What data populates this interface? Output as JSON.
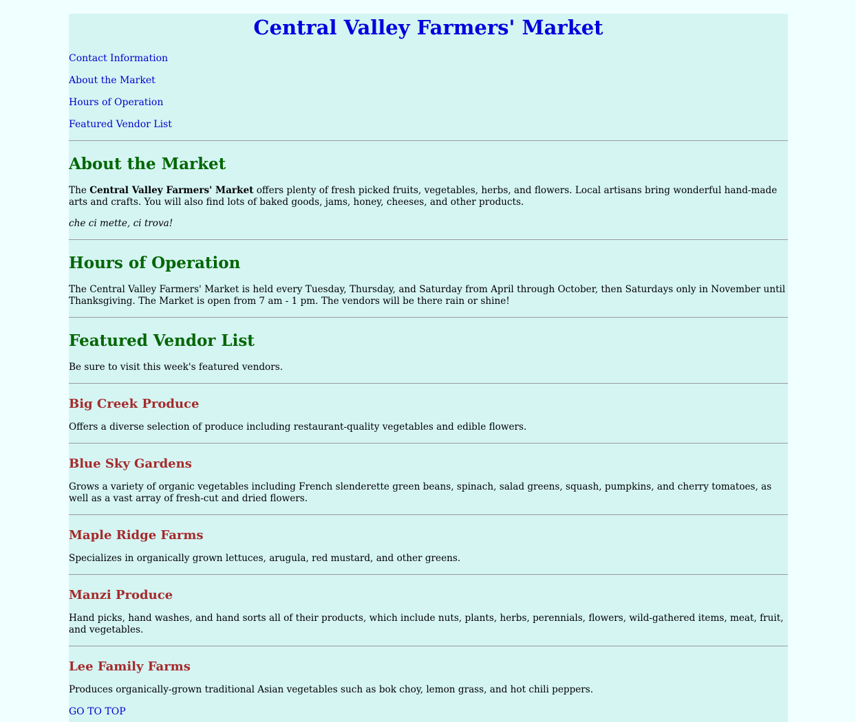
{
  "header": {
    "title": "Central Valley Farmers' Market"
  },
  "nav": {
    "items": [
      {
        "label": "Contact Information"
      },
      {
        "label": "About the Market"
      },
      {
        "label": "Hours of Operation"
      },
      {
        "label": "Featured Vendor List"
      }
    ]
  },
  "about": {
    "heading": "About the Market",
    "intro_prefix": "The ",
    "intro_bold": "Central Valley Farmers' Market",
    "intro_rest": " offers plenty of fresh picked fruits, vegetables, herbs, and flowers. Local artisans bring wonderful hand-made arts and crafts. You will also find lots of baked goods, jams, honey, cheeses, and other products.",
    "motto": "che ci mette, ci trova!"
  },
  "hours": {
    "heading": "Hours of Operation",
    "text": "The Central Valley Farmers' Market is held every Tuesday, Thursday, and Saturday from April through October, then Saturdays only in November until Thanksgiving. The Market is open from 7 am - 1 pm. The vendors will be there rain or shine!"
  },
  "vendors": {
    "heading": "Featured Vendor List",
    "intro": "Be sure to visit this week's featured vendors.",
    "items": [
      {
        "name": "Big Creek Produce",
        "desc": "Offers a diverse selection of produce including restaurant-quality vegetables and edible flowers."
      },
      {
        "name": "Blue Sky Gardens",
        "desc": "Grows a variety of organic vegetables including French slenderette green beans, spinach, salad greens, squash, pumpkins, and cherry tomatoes, as well as a vast array of fresh-cut and dried flowers."
      },
      {
        "name": "Maple Ridge Farms",
        "desc": "Specializes in organically grown lettuces, arugula, red mustard, and other greens."
      },
      {
        "name": "Manzi Produce",
        "desc": "Hand picks, hand washes, and hand sorts all of their products, which include nuts, plants, herbs, perennials, flowers, wild-gathered items, meat, fruit, and vegetables."
      },
      {
        "name": "Lee Family Farms",
        "desc": "Produces organically-grown traditional Asian vegetables such as bok choy, lemon grass, and hot chili peppers."
      }
    ]
  },
  "footer": {
    "top_link": "GO TO TOP"
  },
  "colors": {
    "page_bg": "#f0ffff",
    "content_bg": "#d5f5f3",
    "title": "#0000dd",
    "link": "#0000cc",
    "section_heading": "#006600",
    "vendor_heading": "#a52a2a"
  }
}
